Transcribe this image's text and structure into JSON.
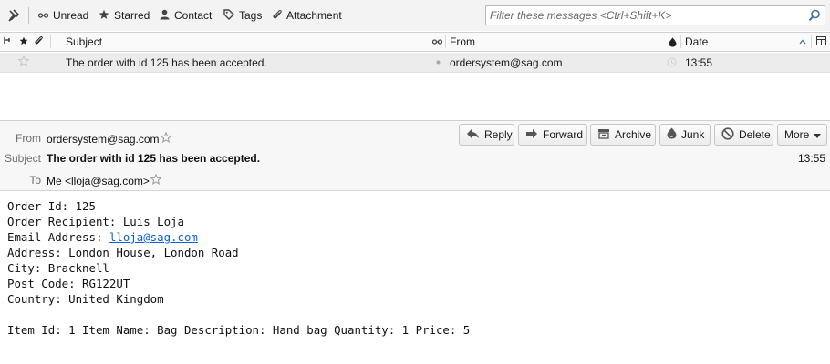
{
  "toolbar": {
    "filters": [
      {
        "label": "Unread",
        "icon": "unread-icon"
      },
      {
        "label": "Starred",
        "icon": "star-icon"
      },
      {
        "label": "Contact",
        "icon": "contact-icon"
      },
      {
        "label": "Tags",
        "icon": "tag-icon"
      },
      {
        "label": "Attachment",
        "icon": "paperclip-icon"
      }
    ],
    "filter_placeholder": "Filter these messages <Ctrl+Shift+K>"
  },
  "thread_columns": {
    "subject": "Subject",
    "from": "From",
    "date": "Date"
  },
  "message_row": {
    "subject": "The order with id 125 has been accepted.",
    "from": "ordersystem@sag.com",
    "date": "13:55"
  },
  "header": {
    "from_label": "From",
    "from_value": "ordersystem@sag.com",
    "subject_label": "Subject",
    "subject_value": "The order with id 125 has been accepted.",
    "to_label": "To",
    "to_value": "Me <lloja@sag.com>",
    "time": "13:55",
    "buttons": {
      "reply": "Reply",
      "forward": "Forward",
      "archive": "Archive",
      "junk": "Junk",
      "delete": "Delete",
      "more": "More"
    }
  },
  "body": {
    "line1": "Order Id: 125",
    "line2": "Order Recipient: Luis Loja",
    "line3_prefix": "Email Address: ",
    "line3_email": "lloja@sag.com",
    "line4": "Address: London House, London Road",
    "line5": "City: Bracknell",
    "line6": "Post Code: RG122UT",
    "line7": "Country: United Kingdom",
    "line9": "Item Id: 1 Item Name: Bag Description: Hand bag Quantity: 1 Price: 5"
  },
  "colors": {
    "link": "#0b5ed7",
    "toolbar_bg": "#f3f3f3",
    "selected_row": "#ececec"
  }
}
